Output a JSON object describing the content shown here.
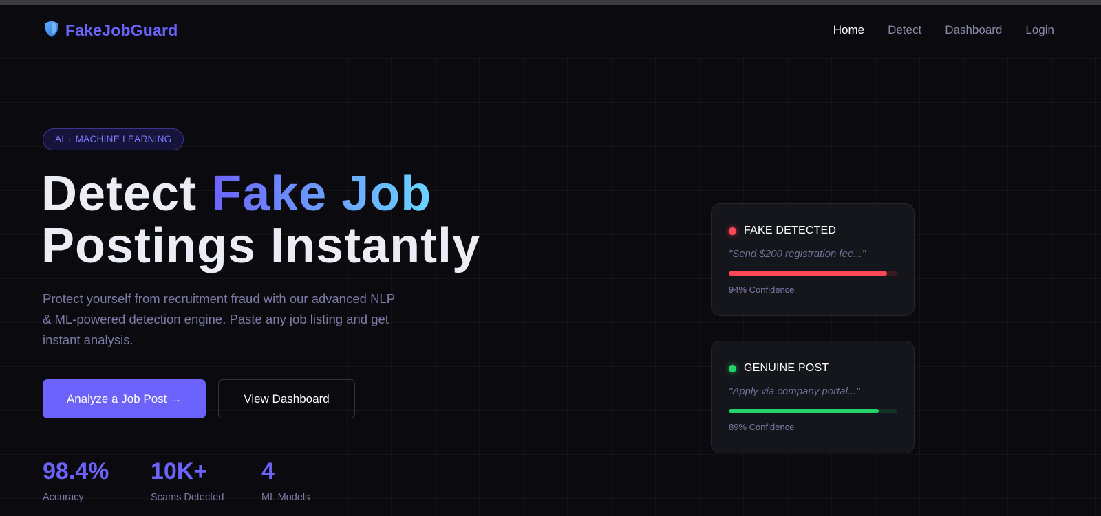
{
  "brand": {
    "name": "FakeJobGuard",
    "icon": "shield-icon",
    "color": "#6c63ff"
  },
  "nav": {
    "links": [
      {
        "label": "Home",
        "active": true
      },
      {
        "label": "Detect",
        "active": false
      },
      {
        "label": "Dashboard",
        "active": false
      },
      {
        "label": "Login",
        "active": false
      }
    ]
  },
  "hero": {
    "badge": "AI + MACHINE LEARNING",
    "headline": {
      "part1": "Detect ",
      "highlight": "Fake Job",
      "part2": "Postings Instantly"
    },
    "subtitle": "Protect yourself from recruitment fraud with our advanced NLP & ML-powered detection engine. Paste any job listing and get instant analysis.",
    "primary_button": "Analyze a Job Post →",
    "secondary_button": "View Dashboard"
  },
  "stats": [
    {
      "value": "98.4%",
      "label": "Accuracy"
    },
    {
      "value": "10K+",
      "label": "Scams Detected"
    },
    {
      "value": "4",
      "label": "ML Models"
    }
  ],
  "cards": [
    {
      "status": "FAKE DETECTED",
      "status_color": "#ff4757",
      "quote": "\"Send $200 registration fee...\"",
      "confidence": 0.94,
      "confidence_label": "94% Confidence"
    },
    {
      "status": "GENUINE POST",
      "status_color": "#22d36b",
      "quote": "\"Apply via company portal...\"",
      "confidence": 0.89,
      "confidence_label": "89% Confidence"
    }
  ],
  "colors": {
    "accent": "#6c63ff",
    "gradient_end": "#6ad4ff",
    "background": "#0b0b0f",
    "danger": "#ff4757",
    "success": "#22d36b"
  }
}
